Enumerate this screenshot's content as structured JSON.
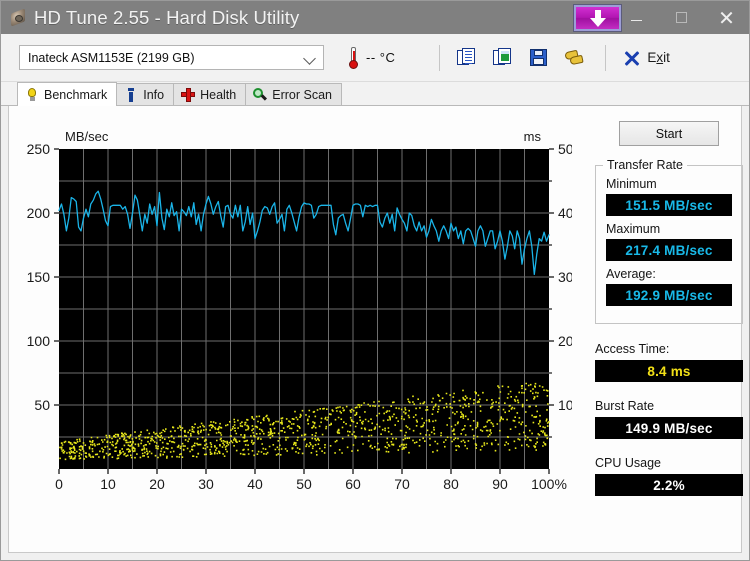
{
  "window": {
    "title": "HD Tune 2.55 - Hard Disk Utility",
    "app_icon": "hard-disk-icon",
    "minimize_label": "–",
    "maximize_label": "□",
    "close_label": "✕",
    "overlay_badge_icon": "download-arrow-icon"
  },
  "toolbar": {
    "drive": {
      "value": "Inateck ASM1153E (2199 GB)",
      "icon": "chevron-down-icon"
    },
    "temperature": {
      "icon": "thermometer-icon",
      "value": "--  °C"
    },
    "buttons": [
      {
        "name": "copy-text-button",
        "icon": "copy-text-icon"
      },
      {
        "name": "copy-image-button",
        "icon": "copy-image-icon"
      },
      {
        "name": "save-button",
        "icon": "floppy-disk-icon"
      },
      {
        "name": "options-button",
        "icon": "boots-icon"
      }
    ],
    "exit": {
      "icon": "x-icon",
      "label_pre": "E",
      "label_underlined": "x",
      "label_post": "it"
    }
  },
  "tabs": [
    {
      "label": "Benchmark",
      "icon": "lightbulb-icon",
      "active": true
    },
    {
      "label": "Info",
      "icon": "info-icon",
      "active": false
    },
    {
      "label": "Health",
      "icon": "red-cross-icon",
      "active": false
    },
    {
      "label": "Error Scan",
      "icon": "magnifier-icon",
      "active": false
    }
  ],
  "results": {
    "start_label": "Start",
    "transfer_rate": {
      "group_label": "Transfer Rate",
      "minimum_label": "Minimum",
      "minimum_value": "151.5 MB/sec",
      "maximum_label": "Maximum",
      "maximum_value": "217.4 MB/sec",
      "average_label": "Average:",
      "average_value": "192.9 MB/sec"
    },
    "access_time_label": "Access Time:",
    "access_time_value": "8.4 ms",
    "burst_rate_label": "Burst Rate",
    "burst_rate_value": "149.9 MB/sec",
    "cpu_usage_label": "CPU Usage",
    "cpu_usage_value": "2.2%"
  },
  "colors": {
    "transfer_line": "#1ab4e8",
    "access_dots": "#e8e81a",
    "plot_background": "#000000",
    "grid": "#6e6e6e",
    "titlebar": "#808080",
    "badge": "#b215b2"
  },
  "chart_data": {
    "type": "line",
    "title": "",
    "xlabel": "",
    "ylabel": "MB/sec",
    "y2label": "ms",
    "xlim": [
      0,
      100
    ],
    "ylim": [
      0,
      250
    ],
    "y2lim": [
      0,
      50
    ],
    "xticks": [
      0,
      10,
      20,
      30,
      40,
      50,
      60,
      70,
      80,
      90,
      100
    ],
    "xticklabels": [
      "0",
      "10",
      "20",
      "30",
      "40",
      "50",
      "60",
      "70",
      "80",
      "90",
      "100%"
    ],
    "yticks": [
      50,
      100,
      150,
      200,
      250
    ],
    "yticklabels": [
      "50",
      "100",
      "150",
      "200",
      "250"
    ],
    "y2ticks": [
      10,
      20,
      30,
      40,
      50
    ],
    "y2ticklabels": [
      "10",
      "20",
      "30",
      "40",
      "50"
    ],
    "grid": true,
    "grid_x_step": 5,
    "grid_y_step": 25,
    "legend": "none",
    "series": [
      {
        "name": "Transfer rate",
        "axis": "left",
        "color": "#1ab4e8",
        "units": "MB/sec",
        "x": [
          0.0,
          0.5,
          1.0,
          1.5,
          2.0,
          2.5,
          3.0,
          3.5,
          4.0,
          4.5,
          5.0,
          5.5,
          6.0,
          6.5,
          7.0,
          7.5,
          8.0,
          8.5,
          9.0,
          9.5,
          10.0,
          10.5,
          11.0,
          11.5,
          12.0,
          12.5,
          13.0,
          13.5,
          14.0,
          14.5,
          15.0,
          15.5,
          16.0,
          16.5,
          17.0,
          17.5,
          18.0,
          18.5,
          19.0,
          19.5,
          20.0,
          20.5,
          21.0,
          21.5,
          22.0,
          22.5,
          23.0,
          23.5,
          24.0,
          24.5,
          25.0,
          25.5,
          26.0,
          26.5,
          27.0,
          27.5,
          28.0,
          28.5,
          29.0,
          29.5,
          30.0,
          30.5,
          31.0,
          31.5,
          32.0,
          32.5,
          33.0,
          33.5,
          34.0,
          34.5,
          35.0,
          35.5,
          36.0,
          36.5,
          37.0,
          37.5,
          38.0,
          38.5,
          39.0,
          39.5,
          40.0,
          40.5,
          41.0,
          41.5,
          42.0,
          42.5,
          43.0,
          43.5,
          44.0,
          44.5,
          45.0,
          45.5,
          46.0,
          46.5,
          47.0,
          47.5,
          48.0,
          48.5,
          49.0,
          49.5,
          50.0,
          50.5,
          51.0,
          51.5,
          52.0,
          52.5,
          53.0,
          53.5,
          54.0,
          54.5,
          55.0,
          55.5,
          56.0,
          56.5,
          57.0,
          57.5,
          58.0,
          58.5,
          59.0,
          59.5,
          60.0,
          60.5,
          61.0,
          61.5,
          62.0,
          62.5,
          63.0,
          63.5,
          64.0,
          64.5,
          65.0,
          65.5,
          66.0,
          66.5,
          67.0,
          67.5,
          68.0,
          68.5,
          69.0,
          69.5,
          70.0,
          70.5,
          71.0,
          71.5,
          72.0,
          72.5,
          73.0,
          73.5,
          74.0,
          74.5,
          75.0,
          75.5,
          76.0,
          76.5,
          77.0,
          77.5,
          78.0,
          78.5,
          79.0,
          79.5,
          80.0,
          80.5,
          81.0,
          81.5,
          82.0,
          82.5,
          83.0,
          83.5,
          84.0,
          84.5,
          85.0,
          85.5,
          86.0,
          86.5,
          87.0,
          87.5,
          88.0,
          88.5,
          89.0,
          89.5,
          90.0,
          90.5,
          91.0,
          91.5,
          92.0,
          92.5,
          93.0,
          93.5,
          94.0,
          94.5,
          95.0,
          95.5,
          96.0,
          96.5,
          97.0,
          97.5,
          98.0,
          98.5,
          99.0,
          99.5,
          100.0
        ],
        "y": [
          202,
          207,
          199,
          186,
          196,
          212,
          211,
          209,
          189,
          186,
          196,
          203,
          197,
          207,
          210,
          215,
          217,
          211,
          203,
          194,
          190,
          205,
          206,
          206,
          206,
          206,
          203,
          205,
          199,
          188,
          200,
          214,
          210,
          198,
          186,
          199,
          192,
          207,
          199,
          205,
          190,
          216,
          196,
          187,
          203,
          197,
          208,
          198,
          201,
          186,
          203,
          201,
          198,
          205,
          197,
          208,
          191,
          199,
          186,
          199,
          207,
          213,
          207,
          199,
          205,
          209,
          198,
          189,
          205,
          206,
          199,
          196,
          206,
          197,
          206,
          186,
          193,
          205,
          191,
          200,
          180,
          186,
          193,
          202,
          205,
          204,
          199,
          205,
          208,
          192,
          195,
          199,
          186,
          203,
          206,
          200,
          193,
          186,
          197,
          205,
          208,
          207,
          207,
          206,
          196,
          199,
          205,
          206,
          206,
          206,
          206,
          206,
          191,
          183,
          196,
          198,
          199,
          192,
          186,
          196,
          206,
          207,
          207,
          206,
          197,
          206,
          205,
          206,
          205,
          206,
          206,
          193,
          189,
          196,
          200,
          192,
          199,
          186,
          204,
          199,
          195,
          192,
          186,
          200,
          198,
          190,
          186,
          193,
          186,
          190,
          181,
          186,
          195,
          190,
          186,
          178,
          186,
          190,
          186,
          180,
          192,
          186,
          189,
          180,
          186,
          176,
          186,
          188,
          186,
          180,
          174,
          186,
          190,
          186,
          174,
          180,
          186,
          186,
          172,
          178,
          186,
          178,
          164,
          174,
          186,
          182,
          172,
          186,
          180,
          160,
          172,
          180,
          186,
          174,
          152,
          168,
          180,
          178,
          185,
          178,
          183
        ]
      },
      {
        "name": "Access time",
        "axis": "right",
        "color": "#e8e81a",
        "units": "ms",
        "type": "scatter",
        "description": "Random access time samples scattered between roughly 2 and 14 ms, density increasing and drifting upward with position on the drive",
        "range_ms": [
          1.5,
          14.0
        ]
      }
    ]
  }
}
